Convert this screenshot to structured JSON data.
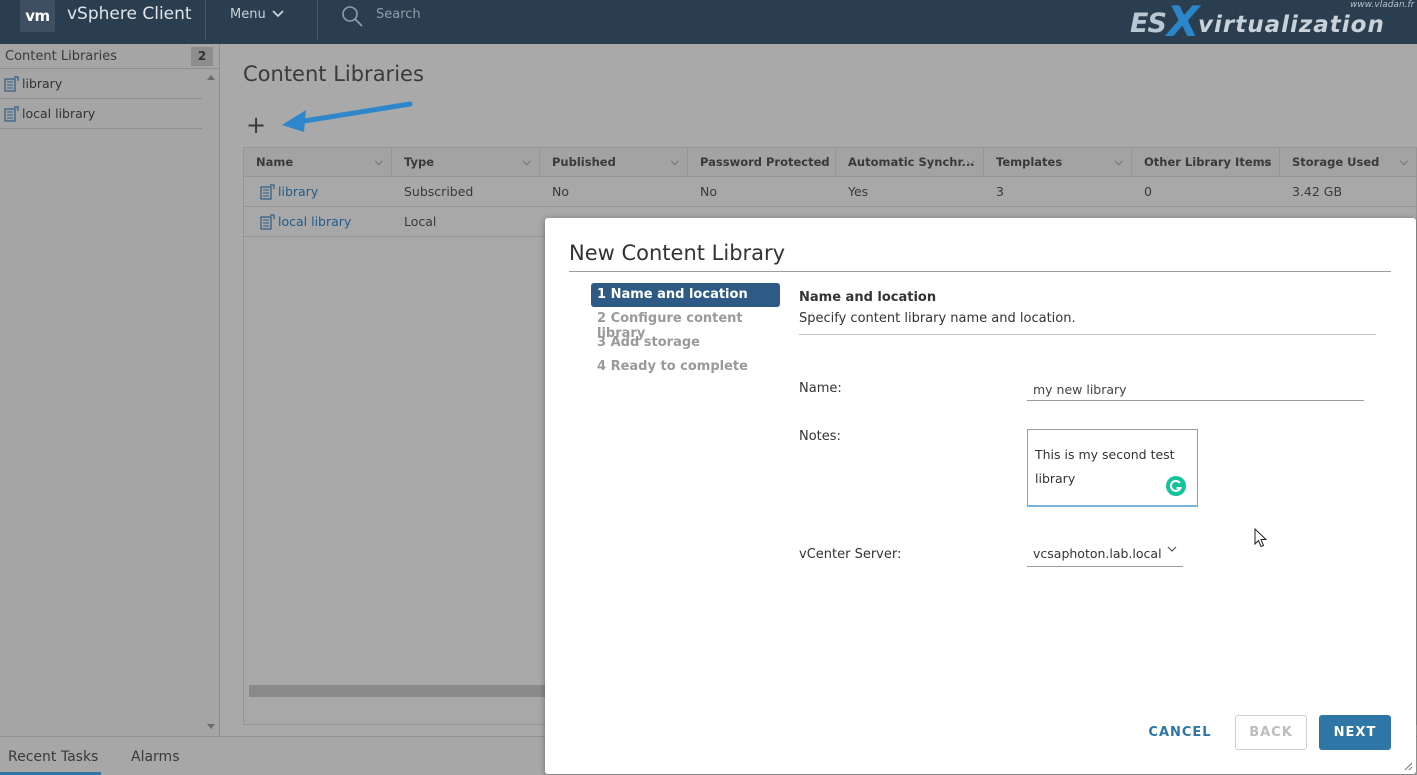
{
  "header": {
    "logo": "vm",
    "app_title": "vSphere Client",
    "menu_label": "Menu",
    "search_label": "Search",
    "watermark_site": "www.vladan.fr",
    "watermark_es": "ES",
    "watermark_x": "X",
    "watermark_rest": "virtualization"
  },
  "sidebar": {
    "title": "Content Libraries",
    "count": "2",
    "items": [
      {
        "label": "library"
      },
      {
        "label": "local library"
      }
    ]
  },
  "main": {
    "title": "Content Libraries",
    "add_symbol": "+",
    "columns": [
      "Name",
      "Type",
      "Published",
      "Password Protected",
      "Automatic Synchr...",
      "Templates",
      "Other Library Items",
      "Storage Used"
    ],
    "rows": [
      {
        "name": "library",
        "type": "Subscribed",
        "published": "No",
        "password": "No",
        "auto_sync": "Yes",
        "templates": "3",
        "other": "0",
        "storage": "3.42 GB"
      },
      {
        "name": "local library",
        "type": "Local"
      }
    ]
  },
  "bottom_tabs": {
    "recent_tasks": "Recent Tasks",
    "alarms": "Alarms"
  },
  "dialog": {
    "title": "New Content Library",
    "steps": [
      {
        "label": "1 Name and location",
        "active": true
      },
      {
        "label": "2 Configure content library"
      },
      {
        "label": "3 Add storage"
      },
      {
        "label": "4 Ready to complete"
      }
    ],
    "pane_title": "Name and location",
    "pane_desc": "Specify content library name and location.",
    "name_label": "Name:",
    "name_value": "my new library",
    "notes_label": "Notes:",
    "notes_value": "This is my second test\nlibrary",
    "vcenter_label": "vCenter Server:",
    "vcenter_value": "vcsaphoton.lab.local",
    "cancel_label": "CANCEL",
    "back_label": "BACK",
    "next_label": "NEXT"
  },
  "colors": {
    "header_bg": "#2b3e50",
    "accent": "#2e76a5",
    "active_step": "#2e5b85",
    "annotation_arrow": "#2e86cb"
  }
}
